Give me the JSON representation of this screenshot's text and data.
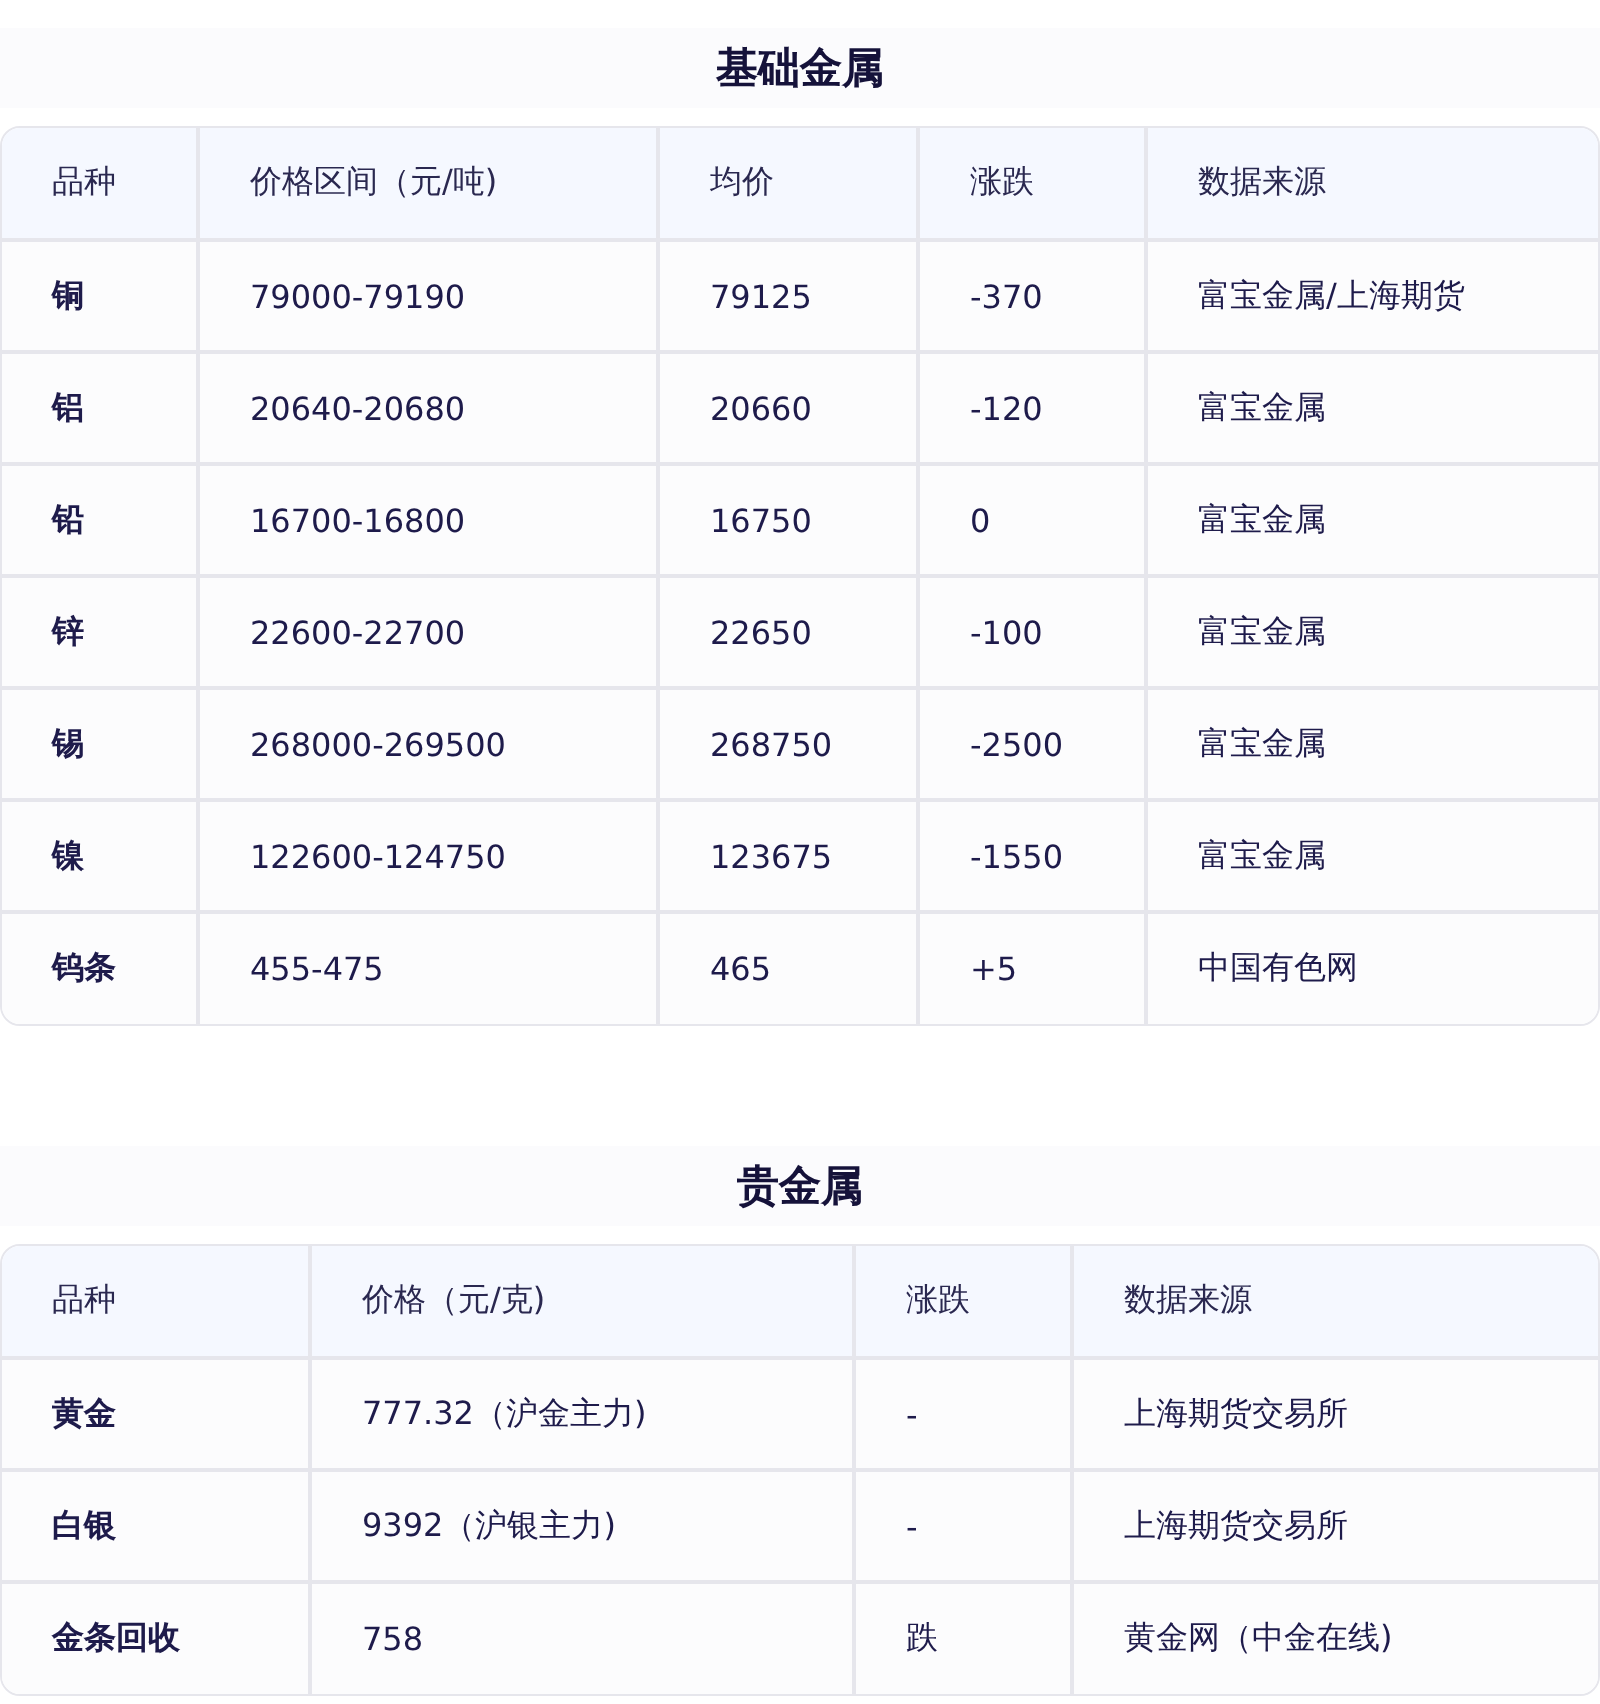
{
  "sections": [
    {
      "title": "基础金属",
      "columns": [
        "品种",
        "价格区间（元/吨)",
        "均价",
        "涨跌",
        "数据来源"
      ],
      "rows": [
        [
          "铜",
          "79000-79190",
          "79125",
          "-370",
          "富宝金属/上海期货"
        ],
        [
          "铝",
          "20640-20680",
          "20660",
          "-120",
          "富宝金属"
        ],
        [
          "铅",
          "16700-16800",
          "16750",
          "0",
          "富宝金属"
        ],
        [
          "锌",
          "22600-22700",
          "22650",
          "-100",
          "富宝金属"
        ],
        [
          "锡",
          "268000-269500",
          "268750",
          "-2500",
          "富宝金属"
        ],
        [
          "镍",
          "122600-124750",
          "123675",
          "-1550",
          "富宝金属"
        ],
        [
          "钨条",
          "455-475",
          "465",
          "+5",
          "中国有色网"
        ]
      ]
    },
    {
      "title": "贵金属",
      "columns": [
        "品种",
        "价格（元/克)",
        "涨跌",
        "数据来源"
      ],
      "rows": [
        [
          "黄金",
          "777.32（沪金主力)",
          "-",
          "上海期货交易所"
        ],
        [
          "白银",
          "9392（沪银主力)",
          "-",
          "上海期货交易所"
        ],
        [
          "金条回收",
          "758",
          "跌",
          "黄金网（中金在线)"
        ]
      ]
    }
  ]
}
